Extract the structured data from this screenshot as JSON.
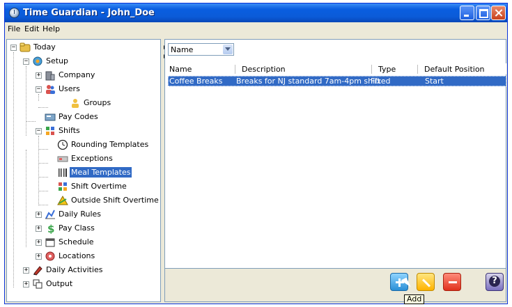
{
  "window": {
    "title": "Time Guardian - John_Doe"
  },
  "menu": [
    "File",
    "Edit",
    "Help"
  ],
  "tree": {
    "nodes": [
      {
        "label": "Today"
      },
      {
        "label": "Setup"
      },
      {
        "label": "Company"
      },
      {
        "label": "Users"
      },
      {
        "label": "Groups"
      },
      {
        "label": "Pay Codes"
      },
      {
        "label": "Shifts"
      },
      {
        "label": "Rounding Templates"
      },
      {
        "label": "Exceptions"
      },
      {
        "label": "Meal Templates"
      },
      {
        "label": "Shift Overtime"
      },
      {
        "label": "Outside Shift Overtime"
      },
      {
        "label": "Daily Rules"
      },
      {
        "label": "Pay Class"
      },
      {
        "label": "Schedule"
      },
      {
        "label": "Locations"
      },
      {
        "label": "Daily Activities"
      },
      {
        "label": "Output"
      }
    ],
    "selected": "Meal Templates"
  },
  "filter": {
    "selected": "Name"
  },
  "grid": {
    "columns": [
      "Name",
      "Description",
      "Type",
      "Default Position"
    ],
    "rows": [
      {
        "name": "Coffee Breaks",
        "description": "Breaks for NJ standard 7am-4pm shift",
        "type": "Fixed",
        "position": "Start"
      }
    ]
  },
  "actions": {
    "tooltip": "Add"
  },
  "colors": {
    "titlebar": "#0a5ee0",
    "selection": "#316ac5",
    "window_bg": "#ece9d8"
  }
}
